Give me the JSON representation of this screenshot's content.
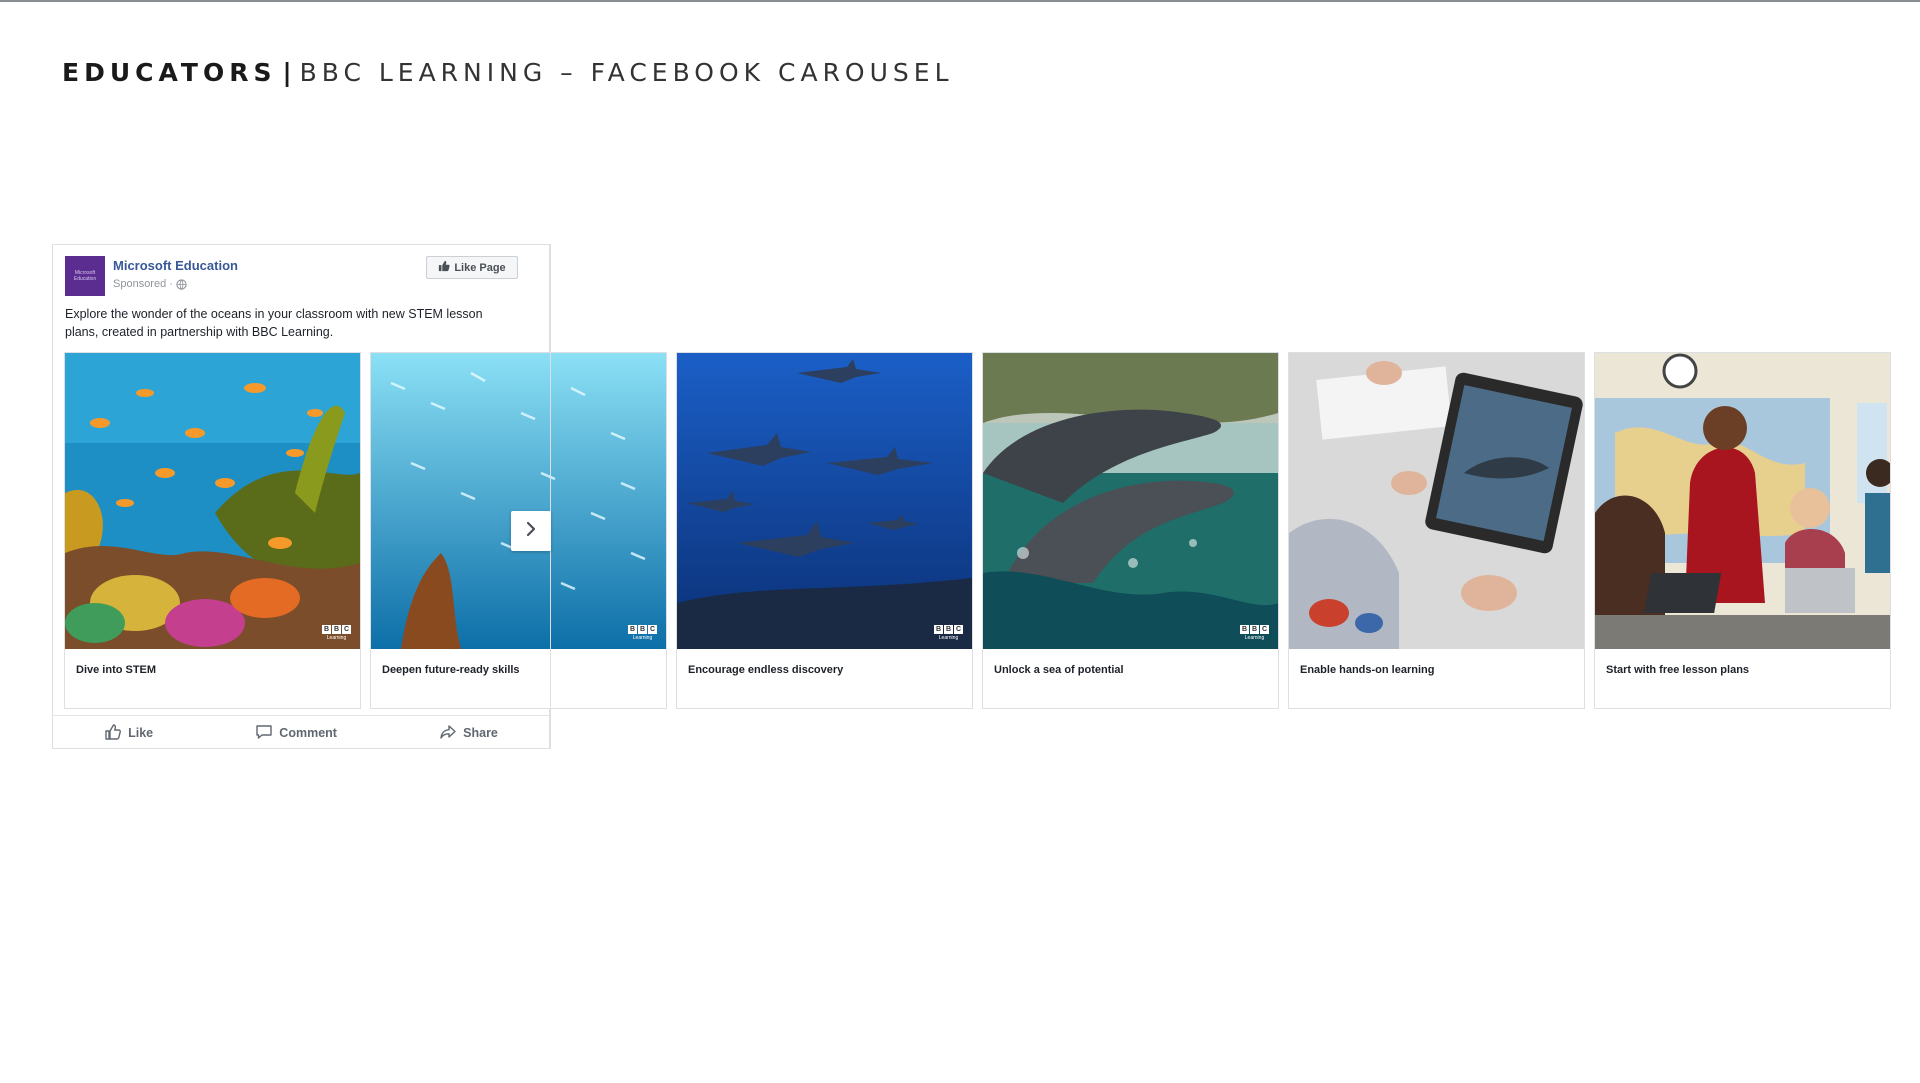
{
  "slide": {
    "title_bold": "EDUCATORS",
    "separator": "|",
    "title_light": "BBC LEARNING – FACEBOOK CAROUSEL"
  },
  "post": {
    "page_name": "Microsoft Education",
    "avatar_text": "Microsoft Education",
    "sponsored": "Sponsored ·",
    "like_page_label": "Like Page",
    "text": "Explore the wonder of the oceans in your classroom with new STEM lesson plans, created in partnership with BBC Learning.",
    "actions": {
      "like": "Like",
      "comment": "Comment",
      "share": "Share"
    }
  },
  "cards": [
    {
      "caption": "Dive into STEM",
      "image": "coral-reef-fish",
      "badge": "BBC Learning"
    },
    {
      "caption": "Deepen future-ready skills",
      "image": "fish-school-diver",
      "badge": "BBC Learning"
    },
    {
      "caption": "Encourage endless discovery",
      "image": "sharks-underwater",
      "badge": "BBC Learning"
    },
    {
      "caption": "Unlock a sea of potential",
      "image": "dolphins-surfacing",
      "badge": "BBC Learning"
    },
    {
      "caption": "Enable hands-on learning",
      "image": "student-tablet-dolphin",
      "badge": ""
    },
    {
      "caption": "Start with free lesson plans",
      "image": "teacher-classroom-laptops",
      "badge": ""
    }
  ],
  "bbc_badge": {
    "letters": [
      "B",
      "B",
      "C"
    ],
    "sub": "Learning"
  },
  "colors": {
    "facebook_link": "#385898",
    "avatar_purple": "#5c2d91",
    "ocean_blue": "#1f5fb8"
  },
  "icons": [
    "like-thumb-icon",
    "comment-bubble-icon",
    "share-arrow-icon",
    "globe-icon",
    "chevron-right-icon"
  ]
}
